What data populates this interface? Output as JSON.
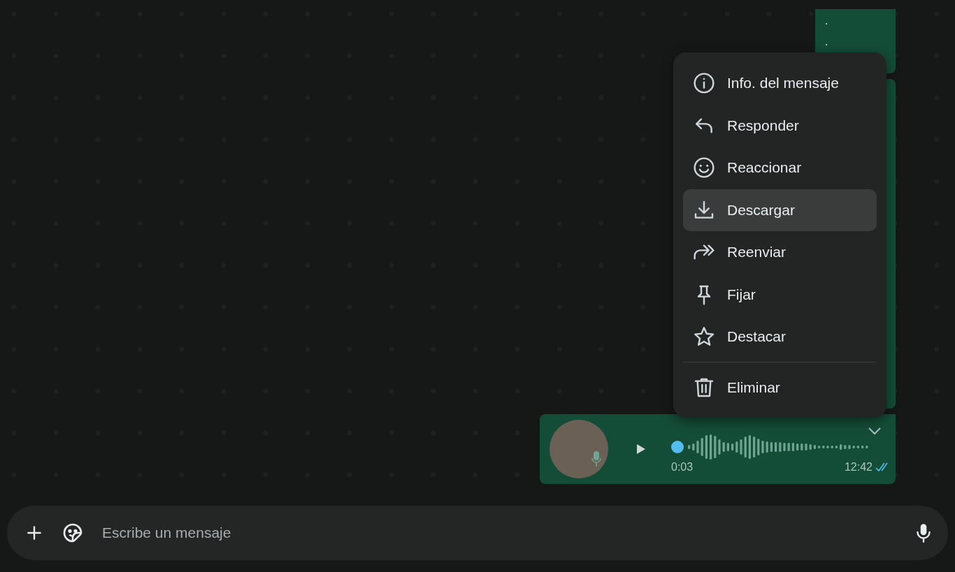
{
  "messages": [
    {
      "kind": "text",
      "lines": [
        ".",
        "."
      ]
    },
    {
      "kind": "hidden"
    },
    {
      "kind": "voice",
      "duration": "0:03",
      "time": "12:42",
      "read": true,
      "level": 0
    }
  ],
  "context_menu": {
    "items": [
      {
        "kind": "info",
        "label": "Info. del mensaje",
        "selected": false
      },
      {
        "kind": "reply",
        "label": "Responder",
        "selected": false
      },
      {
        "kind": "react",
        "label": "Reaccionar",
        "selected": false
      },
      {
        "kind": "download",
        "label": "Descargar",
        "selected": true
      },
      {
        "kind": "forward",
        "label": "Reenviar",
        "selected": false
      },
      {
        "kind": "pin",
        "label": "Fijar",
        "selected": false
      },
      {
        "kind": "star",
        "label": "Destacar",
        "selected": false
      },
      {
        "kind": "divider"
      },
      {
        "kind": "delete",
        "label": "Eliminar",
        "selected": false
      }
    ]
  },
  "composer": {
    "placeholder": "Escribe un mensaje"
  }
}
